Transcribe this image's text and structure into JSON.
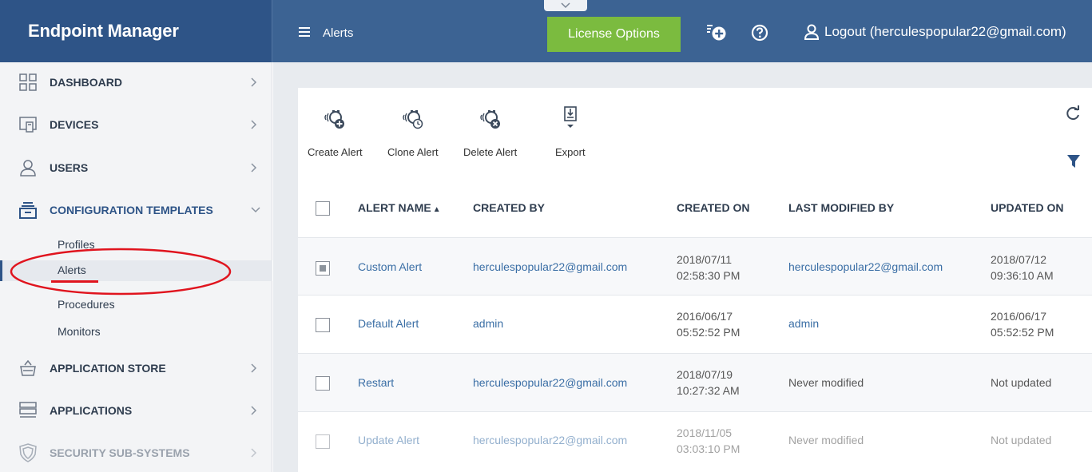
{
  "header": {
    "brand": "Endpoint Manager",
    "page_title": "Alerts",
    "license_button": "License Options",
    "logout_label": "Logout (herculespopular22@gmail.com)"
  },
  "sidebar": {
    "items": [
      {
        "label": "DASHBOARD",
        "icon": "dashboard-icon"
      },
      {
        "label": "DEVICES",
        "icon": "devices-icon"
      },
      {
        "label": "USERS",
        "icon": "user-icon"
      },
      {
        "label": "CONFIGURATION TEMPLATES",
        "icon": "configuration-templates-icon"
      },
      {
        "label": "APPLICATION STORE",
        "icon": "application-store-icon"
      },
      {
        "label": "APPLICATIONS",
        "icon": "applications-icon"
      },
      {
        "label": "SECURITY SUB-SYSTEMS",
        "icon": "security-shield-icon"
      }
    ],
    "subitems": [
      "Profiles",
      "Alerts",
      "Procedures",
      "Monitors"
    ],
    "active_subitem": "Alerts"
  },
  "toolbar": {
    "create": "Create Alert",
    "clone": "Clone Alert",
    "delete": "Delete Alert",
    "export": "Export"
  },
  "table": {
    "columns": [
      "ALERT NAME",
      "CREATED BY",
      "CREATED ON",
      "LAST MODIFIED BY",
      "UPDATED ON"
    ],
    "sort_indicator": "▲",
    "rows": [
      {
        "name": "Custom Alert",
        "created_by": "herculespopular22@gmail.com",
        "created_on_date": "2018/07/11",
        "created_on_time": "02:58:30 PM",
        "modified_by": "herculespopular22@gmail.com",
        "updated_on_date": "2018/07/12",
        "updated_on_time": "09:36:10 AM",
        "checked": true
      },
      {
        "name": "Default Alert",
        "created_by": "admin",
        "created_on_date": "2016/06/17",
        "created_on_time": "05:52:52 PM",
        "modified_by": "admin",
        "updated_on_date": "2016/06/17",
        "updated_on_time": "05:52:52 PM",
        "checked": false
      },
      {
        "name": "Restart",
        "created_by": "herculespopular22@gmail.com",
        "created_on_date": "2018/07/19",
        "created_on_time": "10:27:32 AM",
        "modified_by": "Never modified",
        "updated_on": "Not updated",
        "checked": false
      },
      {
        "name": "Update Alert",
        "created_by": "herculespopular22@gmail.com",
        "created_on_date": "2018/11/05",
        "created_on_time": "03:03:10 PM",
        "modified_by": "Never modified",
        "updated_on": "Not updated",
        "checked": false
      }
    ]
  },
  "colors": {
    "header_bg": "#3c6393",
    "brand_bg": "#2e5487",
    "license_green": "#7bbb3f",
    "link_blue": "#3a6ea5",
    "annotation_red": "#e0141e"
  }
}
